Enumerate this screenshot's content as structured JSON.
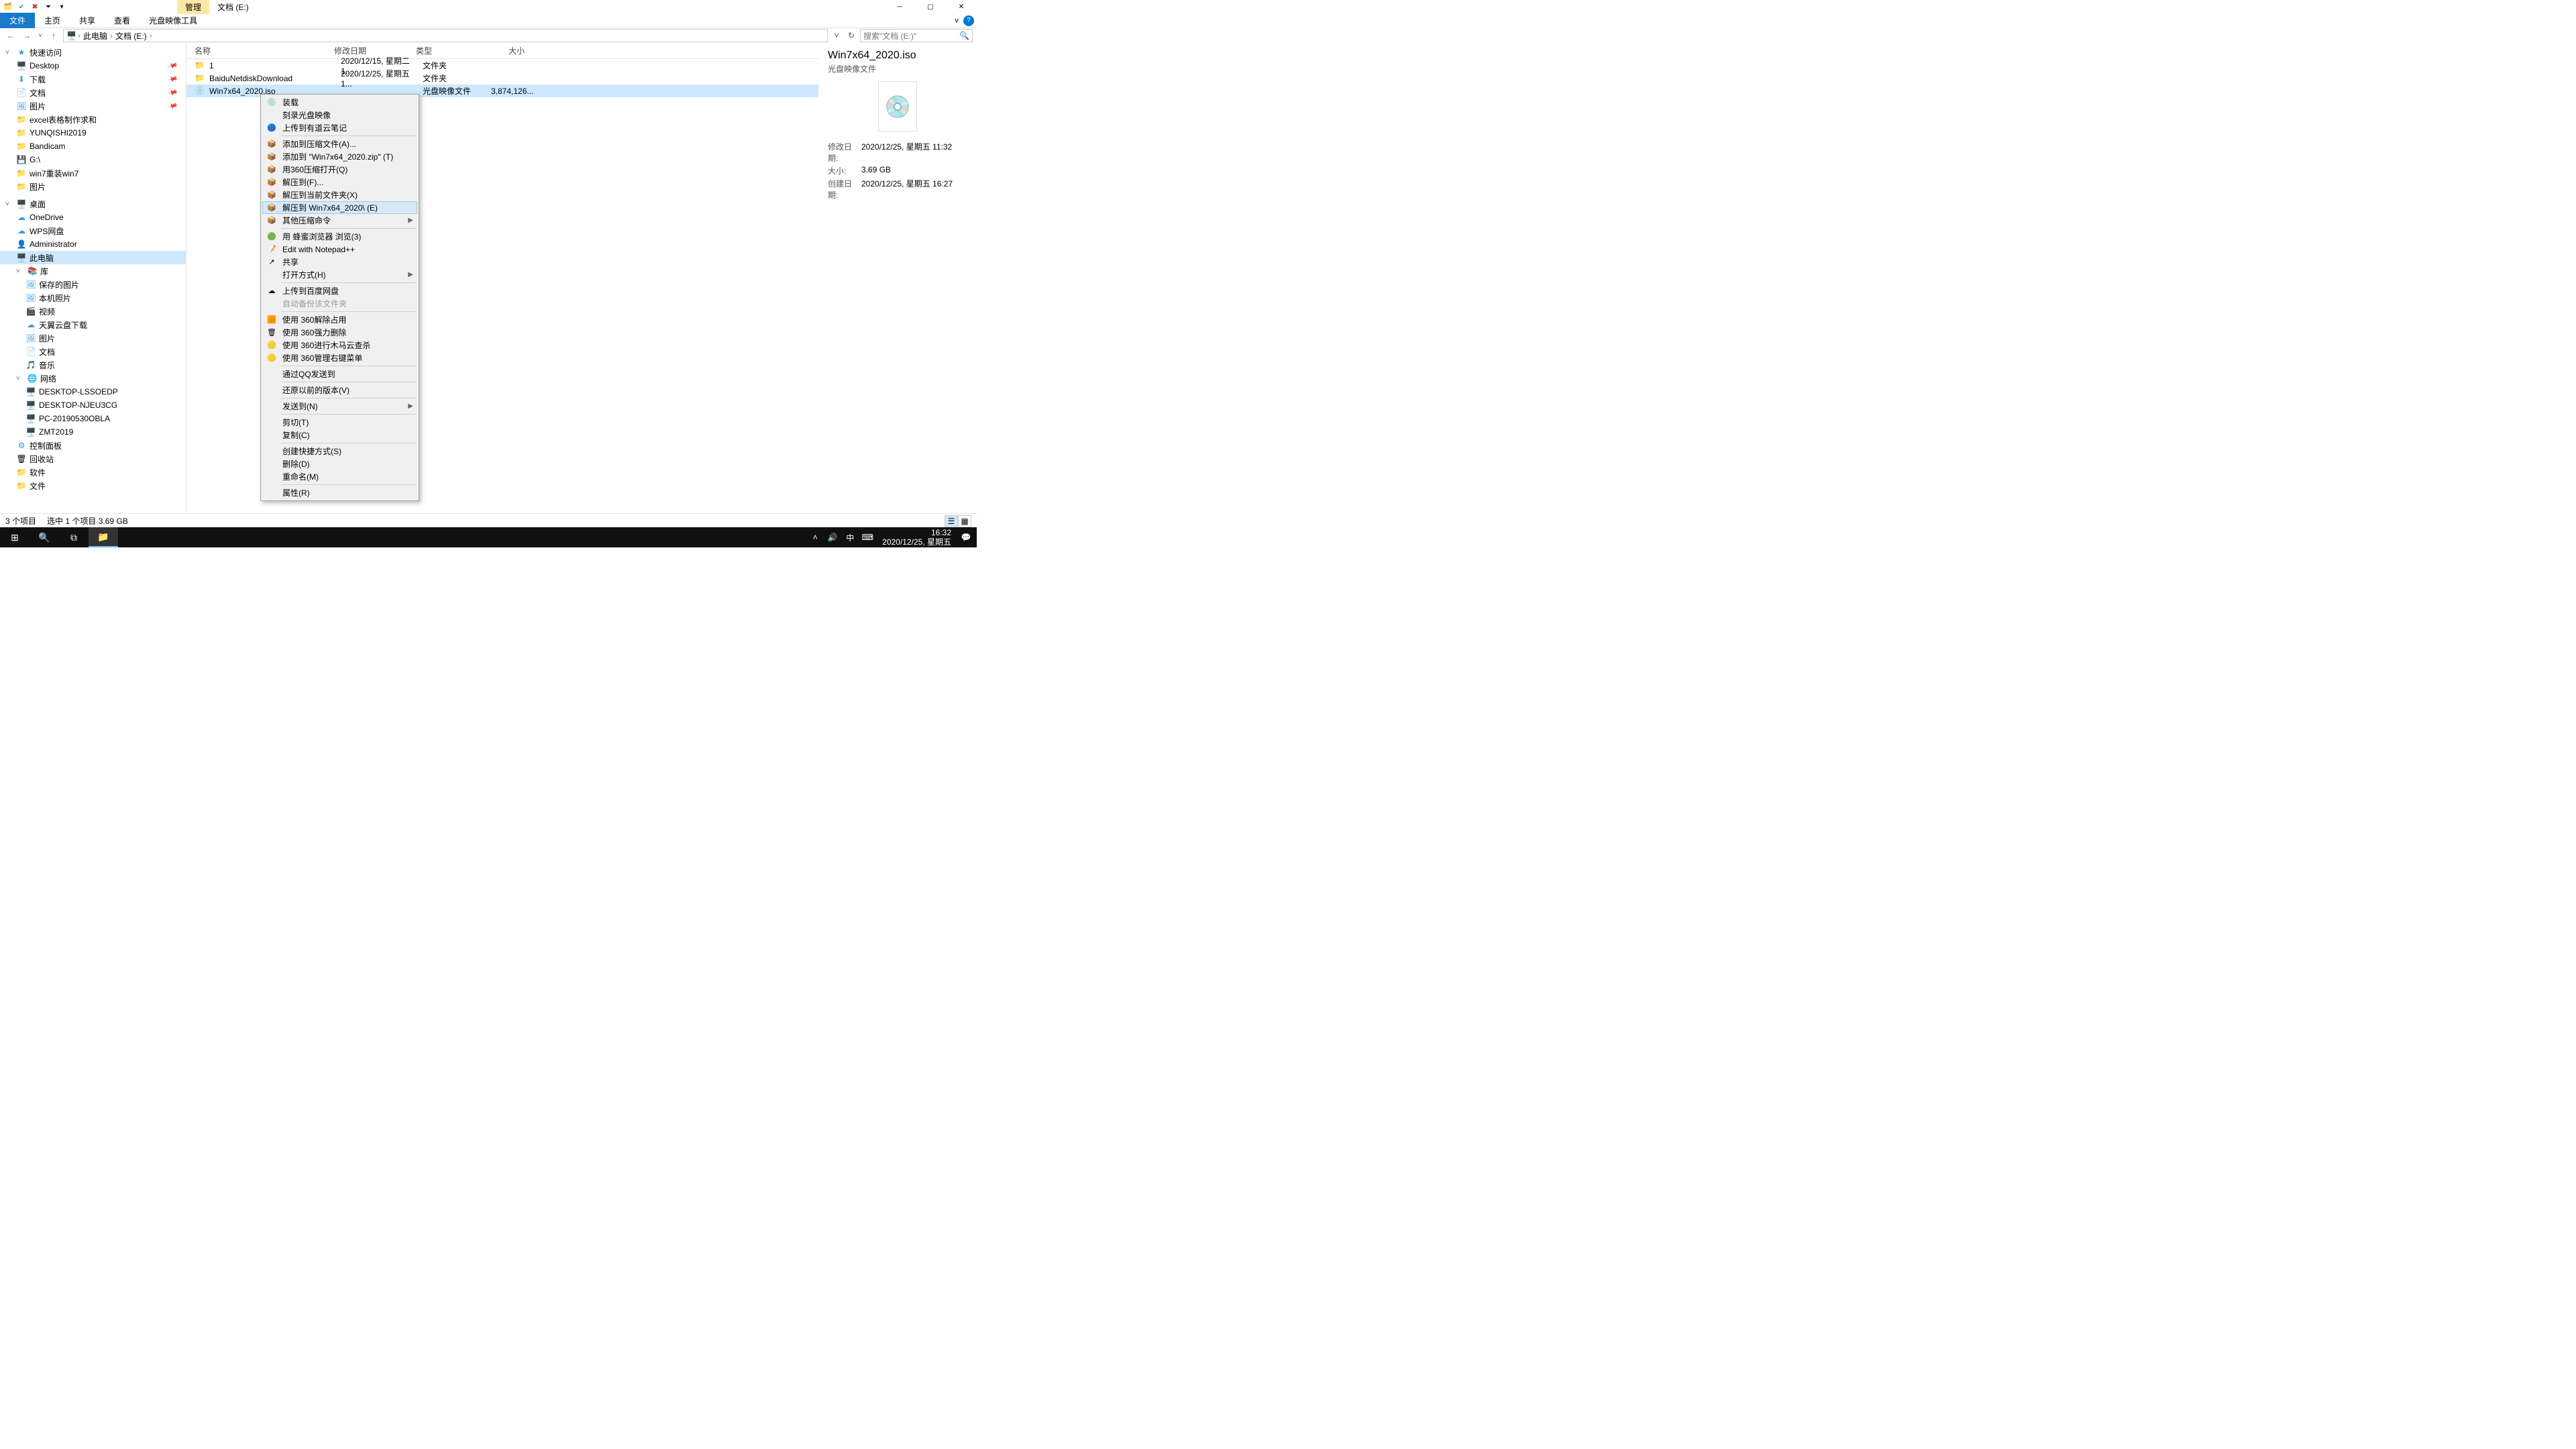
{
  "window": {
    "title_tab": "管理",
    "title_loc": "文档 (E:)",
    "ribbon": {
      "file": "文件",
      "home": "主页",
      "share": "共享",
      "view": "查看",
      "tool": "光盘映像工具"
    }
  },
  "addr": {
    "this_pc": "此电脑",
    "drive": "文档 (E:)",
    "search_placeholder": "搜索\"文档 (E:)\""
  },
  "tree": {
    "quick": "快速访问",
    "desktop": "Desktop",
    "downloads": "下载",
    "docs": "文档",
    "pics": "图片",
    "excel": "excel表格制作求和",
    "yunqishi": "YUNQISHI2019",
    "bandicam": "Bandicam",
    "g": "G:\\",
    "win7r": "win7重装win7",
    "pics2": "图片",
    "desk": "桌面",
    "onedrive": "OneDrive",
    "wps": "WPS网盘",
    "admin": "Administrator",
    "thispc": "此电脑",
    "lib": "库",
    "saved_pics": "保存的图片",
    "local_pics": "本机照片",
    "videos": "视频",
    "tianyi": "天翼云盘下载",
    "lib_pics": "图片",
    "lib_docs": "文档",
    "music": "音乐",
    "network": "网络",
    "pc1": "DESKTOP-LSSOEDP",
    "pc2": "DESKTOP-NJEU3CG",
    "pc3": "PC-20190530OBLA",
    "pc4": "ZMT2019",
    "cpanel": "控制面板",
    "recycle": "回收站",
    "soft": "软件",
    "files": "文件"
  },
  "columns": {
    "name": "名称",
    "date": "修改日期",
    "type": "类型",
    "size": "大小"
  },
  "rows": [
    {
      "name": "1",
      "date": "2020/12/15, 星期二 1...",
      "type": "文件夹",
      "size": "",
      "icon": "folder"
    },
    {
      "name": "BaiduNetdiskDownload",
      "date": "2020/12/25, 星期五 1...",
      "type": "文件夹",
      "size": "",
      "icon": "folder"
    },
    {
      "name": "Win7x64_2020.iso",
      "date": "",
      "type": "光盘映像文件",
      "size": "3,874,126...",
      "icon": "disc",
      "selected": true
    }
  ],
  "context": [
    {
      "label": "装载",
      "icon": "💿"
    },
    {
      "label": "刻录光盘映像"
    },
    {
      "label": "上传到有道云笔记",
      "icon": "🔵"
    },
    {
      "sep": true
    },
    {
      "label": "添加到压缩文件(A)...",
      "icon": "📦"
    },
    {
      "label": "添加到 \"Win7x64_2020.zip\" (T)",
      "icon": "📦"
    },
    {
      "label": "用360压缩打开(Q)",
      "icon": "📦"
    },
    {
      "label": "解压到(F)...",
      "icon": "📦"
    },
    {
      "label": "解压到当前文件夹(X)",
      "icon": "📦"
    },
    {
      "label": "解压到 Win7x64_2020\\ (E)",
      "icon": "📦",
      "hovered": true
    },
    {
      "label": "其他压缩命令",
      "icon": "📦",
      "arrow": true
    },
    {
      "sep": true
    },
    {
      "label": "用 蜂蜜浏览器 浏览(3)",
      "icon": "🟢"
    },
    {
      "label": "Edit with Notepad++",
      "icon": "📝"
    },
    {
      "label": "共享",
      "icon": "↗"
    },
    {
      "label": "打开方式(H)",
      "arrow": true
    },
    {
      "sep": true
    },
    {
      "label": "上传到百度网盘",
      "icon": "☁"
    },
    {
      "label": "自动备份该文件夹",
      "disabled": true
    },
    {
      "sep": true
    },
    {
      "label": "使用 360解除占用",
      "icon": "🟧"
    },
    {
      "label": "使用 360强力删除",
      "icon": "🗑"
    },
    {
      "label": "使用 360进行木马云查杀",
      "icon": "🟡"
    },
    {
      "label": "使用 360管理右键菜单",
      "icon": "🟡"
    },
    {
      "sep": true
    },
    {
      "label": "通过QQ发送到"
    },
    {
      "sep": true
    },
    {
      "label": "还原以前的版本(V)"
    },
    {
      "sep": true
    },
    {
      "label": "发送到(N)",
      "arrow": true
    },
    {
      "sep": true
    },
    {
      "label": "剪切(T)"
    },
    {
      "label": "复制(C)"
    },
    {
      "sep": true
    },
    {
      "label": "创建快捷方式(S)"
    },
    {
      "label": "删除(D)"
    },
    {
      "label": "重命名(M)"
    },
    {
      "sep": true
    },
    {
      "label": "属性(R)"
    }
  ],
  "details": {
    "title": "Win7x64_2020.iso",
    "type": "光盘映像文件",
    "mod_label": "修改日期:",
    "mod": "2020/12/25, 星期五 11:32",
    "size_label": "大小:",
    "size": "3.69 GB",
    "created_label": "创建日期:",
    "created": "2020/12/25, 星期五 16:27"
  },
  "status": {
    "count": "3 个项目",
    "selection": "选中 1 个项目  3.69 GB"
  },
  "taskbar": {
    "time": "16:32",
    "date": "2020/12/25, 星期五",
    "ime": "中"
  }
}
